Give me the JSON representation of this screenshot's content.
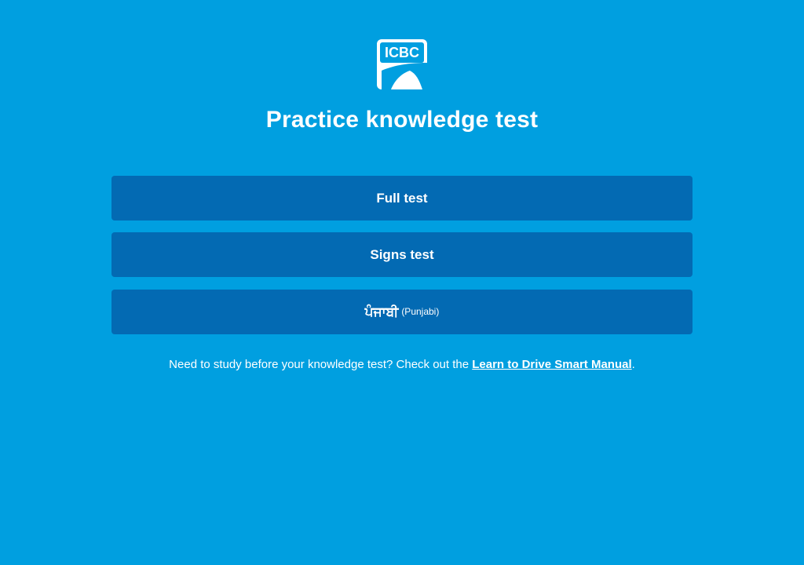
{
  "logo": {
    "text": "ICBC"
  },
  "title": "Practice knowledge test",
  "buttons": {
    "full_test": "Full test",
    "signs_test": "Signs test",
    "punjabi_main": "ਪੰਜਾਬੀ",
    "punjabi_sub": "(Punjabi)"
  },
  "study": {
    "prefix": "Need to study before your knowledge test? Check out the ",
    "link": "Learn to Drive Smart Manual",
    "suffix": "."
  },
  "colors": {
    "background": "#009fe0",
    "button": "#036ab3",
    "text": "#ffffff"
  }
}
